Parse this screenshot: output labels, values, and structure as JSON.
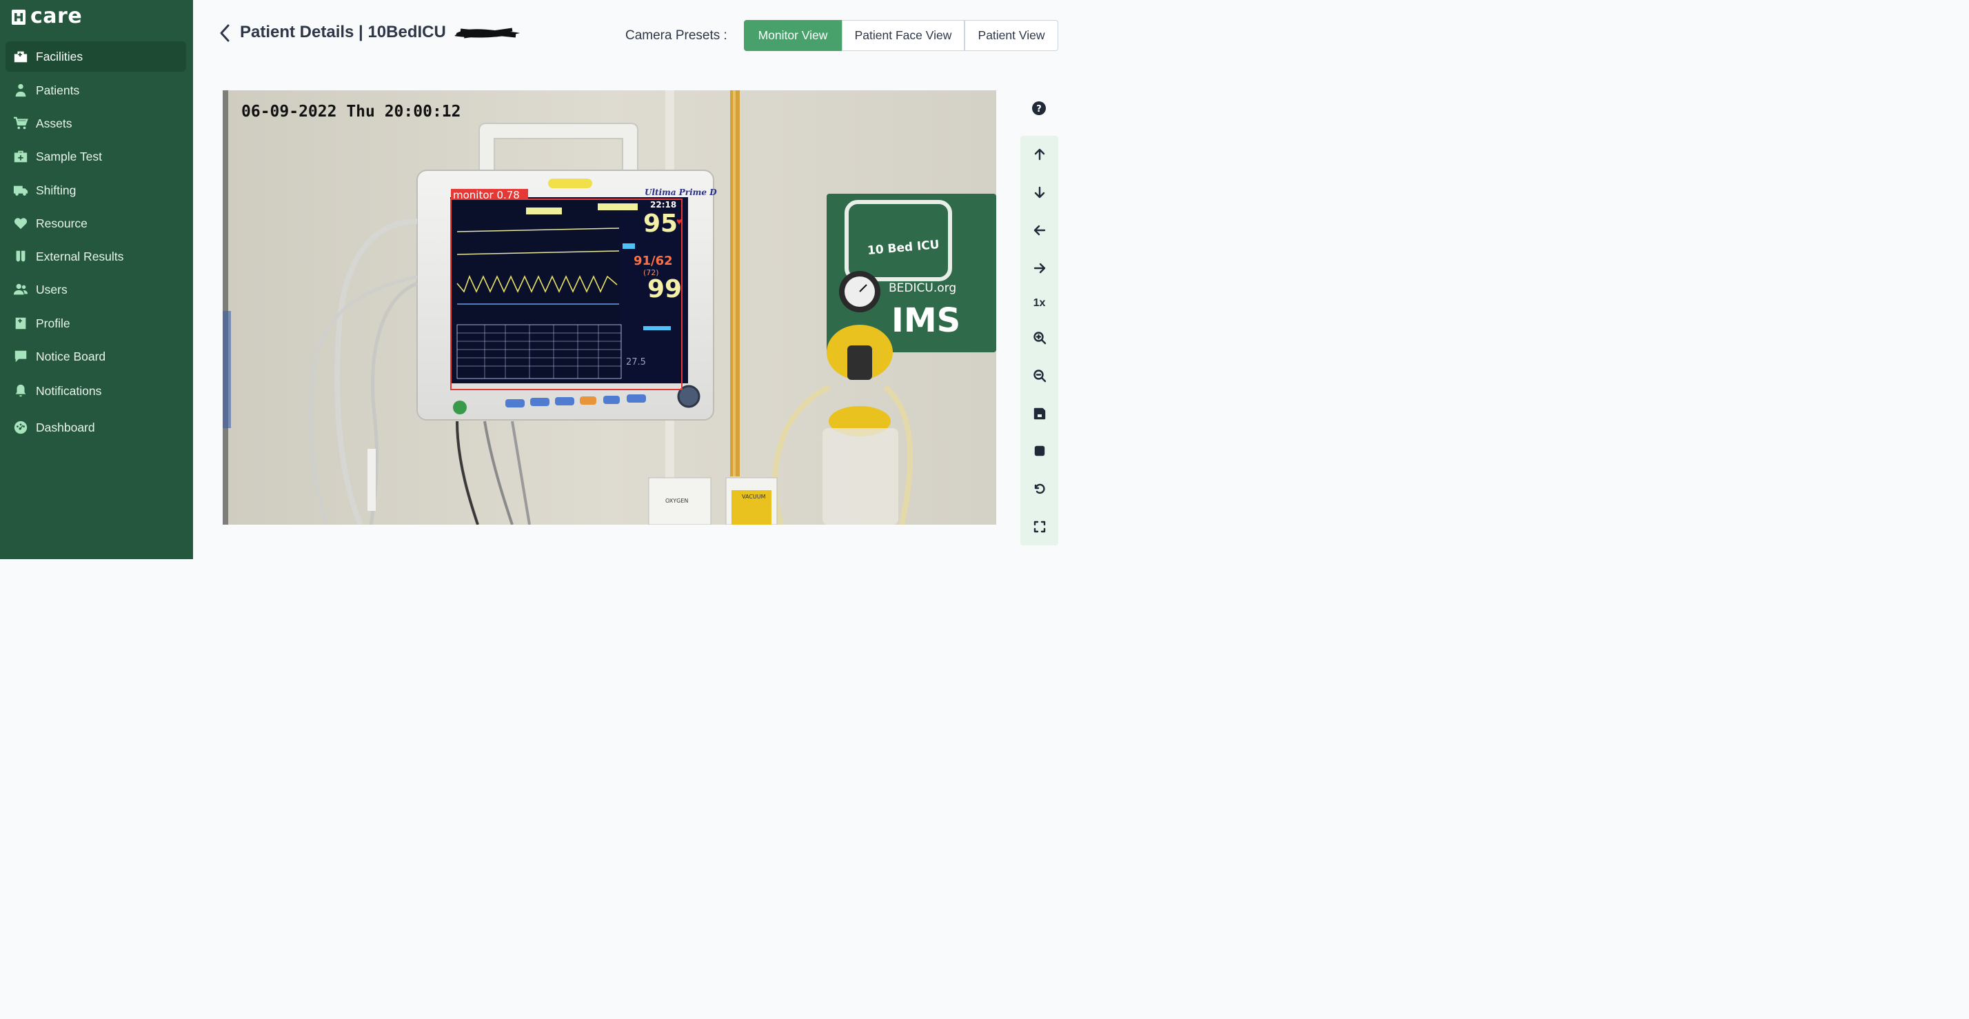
{
  "app": {
    "logo_text": "care"
  },
  "sidebar": {
    "items": [
      {
        "label": "Facilities",
        "icon": "hospital-icon",
        "active": true
      },
      {
        "label": "Patients",
        "icon": "user-injured-icon"
      },
      {
        "label": "Assets",
        "icon": "cart-icon"
      },
      {
        "label": "Sample Test",
        "icon": "medkit-icon"
      },
      {
        "label": "Shifting",
        "icon": "ambulance-icon"
      },
      {
        "label": "Resource",
        "icon": "heartbeat-icon"
      },
      {
        "label": "External Results",
        "icon": "vials-icon"
      },
      {
        "label": "Users",
        "icon": "users-icon"
      },
      {
        "label": "Profile",
        "icon": "hospital-user-icon"
      },
      {
        "label": "Notice Board",
        "icon": "comment-icon"
      },
      {
        "label": "Notifications",
        "icon": "bell-icon"
      },
      {
        "label": "Dashboard",
        "icon": "tachometer-icon"
      }
    ]
  },
  "header": {
    "title": "Patient Details | 10BedICU",
    "presets_label": "Camera Presets :",
    "presets": [
      {
        "label": "Monitor View",
        "active": true
      },
      {
        "label": "Patient Face View",
        "active": false
      },
      {
        "label": "Patient View",
        "active": false
      }
    ]
  },
  "feed": {
    "timestamp": "06-09-2022 Thu 20:00:12",
    "detection_label": "monitor 0.78",
    "monitor_brand": "Ultima Prime D",
    "monitor_time": "22:18",
    "heart_rate": "95",
    "bp": "91/62",
    "map": "(72)",
    "spo2": "99",
    "temp": "27.5",
    "wall_sign_text": "10 Bed ICU",
    "wall_sign_url": "BEDICU.org",
    "wall_sign_sub": "IMS",
    "oxygen_label": "OXYGEN",
    "vacuum_label": "VACUUM"
  },
  "controls": {
    "zoom_level": "1x",
    "items": [
      "help-icon",
      "arrow-up-icon",
      "arrow-down-icon",
      "arrow-left-icon",
      "arrow-right-icon",
      "zoom-level",
      "zoom-in-icon",
      "zoom-out-icon",
      "save-icon",
      "stop-icon",
      "reset-icon",
      "fullscreen-icon"
    ]
  },
  "colors": {
    "sidebar": "#24573d",
    "accent": "#48a16b",
    "detection_box": "#e53935"
  }
}
